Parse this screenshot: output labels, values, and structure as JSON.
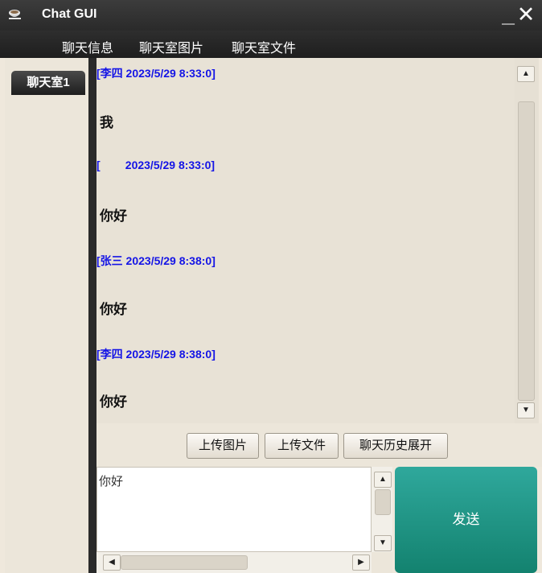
{
  "window": {
    "title": "Chat GUI",
    "minimize_label": "_",
    "close_label": "✕"
  },
  "menu": {
    "items": [
      "聊天信息",
      "聊天室图片",
      "聊天室文件"
    ]
  },
  "rooms": {
    "tabs": [
      "聊天室1"
    ]
  },
  "messages": [
    {
      "header": "[李四 2023/5/29 8:33:0]",
      "body": "我"
    },
    {
      "header": "[        2023/5/29 8:33:0]",
      "body": "你好"
    },
    {
      "header": "[张三 2023/5/29 8:38:0]",
      "body": "你好"
    },
    {
      "header": "[李四 2023/5/29 8:38:0]",
      "body": "你好"
    }
  ],
  "actions": {
    "upload_image": "上传图片",
    "upload_file": "上传文件",
    "expand_history": "聊天历史展开"
  },
  "input": {
    "value": "你好"
  },
  "send": {
    "label": "发送"
  },
  "colors": {
    "accent": "#1a9a8a",
    "header_text": "#1414e6",
    "titlebar": "#2e2e2e"
  }
}
